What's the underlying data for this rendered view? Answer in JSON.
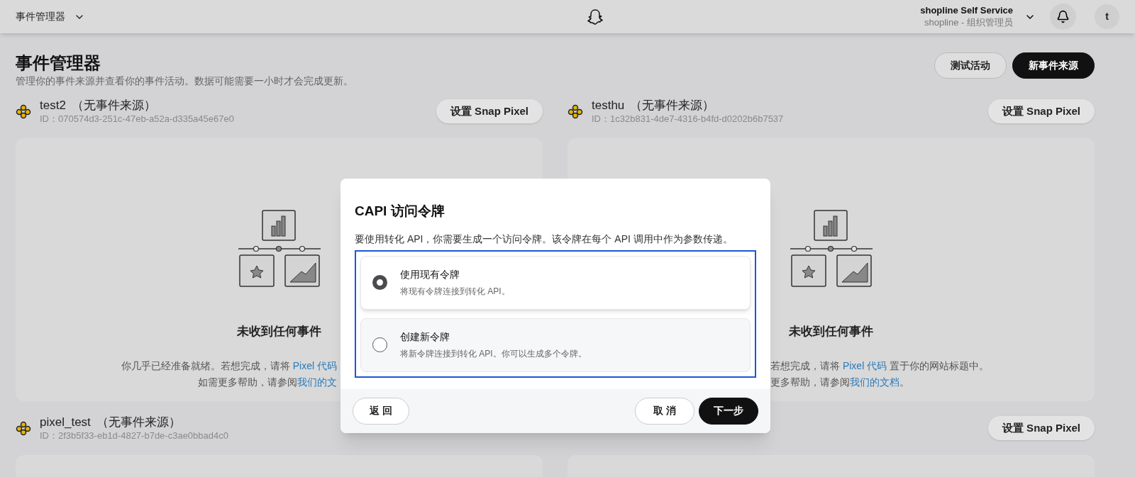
{
  "header": {
    "menu_label": "事件管理器",
    "user_name": "shopline Self Service",
    "user_role": "shopline - 组织管理员",
    "avatar_letter": "t"
  },
  "page": {
    "title": "事件管理器",
    "subtitle": "管理你的事件来源并查看你的事件活动。数据可能需要一小时才会完成更新。",
    "actions": [
      {
        "label": "测试活动",
        "kind": "secondary"
      },
      {
        "label": "新事件来源",
        "kind": "primary"
      }
    ]
  },
  "sources": [
    {
      "name": "test2",
      "status": "（无事件来源）",
      "id": "ID：070574d3-251c-47eb-a52a-d335a45e67e0",
      "button": "设置 Snap Pixel",
      "card": {
        "title": "未收到任何事件",
        "lines": [
          [
            {
              "text": "你几乎已经准备就绪。若想完成，请将 ",
              "link": false
            },
            {
              "text": "Pixel 代码",
              "link": true
            }
          ],
          [
            {
              "text": "如需更多帮助，请参阅",
              "link": false
            },
            {
              "text": "我们的文",
              "link": true
            }
          ]
        ]
      }
    },
    {
      "name": "testhu",
      "status": "（无事件来源）",
      "id": "ID：1c32b831-4de7-4316-b4fd-d0202b6b7537",
      "button": "设置 Snap Pixel",
      "card": {
        "title": "未收到任何事件",
        "lines": [
          [
            {
              "text": "若想完成，请将 ",
              "link": false
            },
            {
              "text": "Pixel 代码",
              "link": true
            },
            {
              "text": " 置于你的网站标题中。",
              "link": false
            }
          ],
          [
            {
              "text": "更多帮助，请参阅",
              "link": false
            },
            {
              "text": "我们的文档",
              "link": true
            },
            {
              "text": "。",
              "link": false
            }
          ]
        ]
      }
    },
    {
      "name": "pixel_test",
      "status": "（无事件来源）",
      "id": "ID：2f3b5f33-eb1d-4827-b7de-c3ae0bbad4c0"
    },
    {
      "button": "设置 Snap Pixel"
    }
  ],
  "dialog": {
    "title": "CAPI 访问令牌",
    "description": "要使用转化 API，你需要生成一个访问令牌。该令牌在每个 API 调用中作为参数传递。",
    "options": [
      {
        "title": "使用现有令牌",
        "description": "将现有令牌连接到转化 API。",
        "selected": true
      },
      {
        "title": "创建新令牌",
        "description": "将新令牌连接到转化 API。你可以生成多个令牌。",
        "selected": false
      }
    ],
    "buttons": [
      {
        "label": "返 回",
        "kind": "back"
      },
      {
        "label": "取 消",
        "kind": "secondary"
      },
      {
        "label": "下一步",
        "kind": "primary"
      }
    ]
  }
}
